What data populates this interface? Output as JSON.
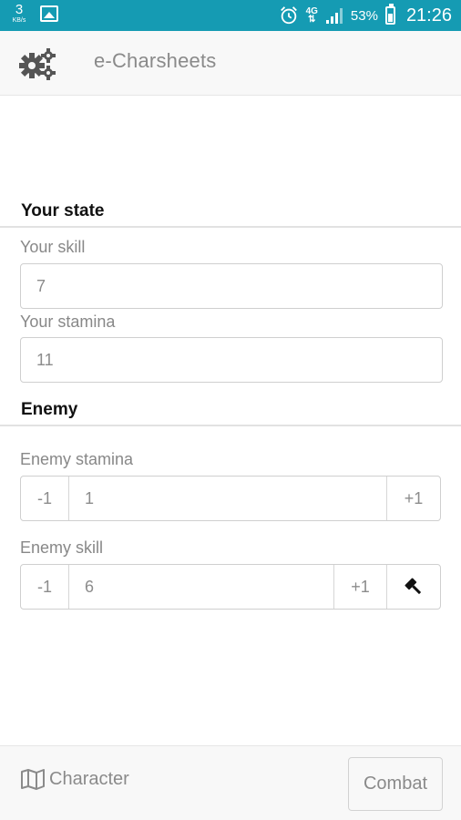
{
  "status_bar": {
    "net_speed": "3",
    "net_unit": "KB/s",
    "network_type": "4G",
    "battery_percent": "53%",
    "battery_level": 0.53,
    "time": "21:26",
    "icons": [
      "gallery-icon",
      "alarm-icon",
      "signal-icon",
      "battery-icon"
    ]
  },
  "header": {
    "title": "e-Charsheets",
    "settings_icon": "gears-icon"
  },
  "your_state": {
    "title": "Your state",
    "skill_label": "Your skill",
    "skill_value": "7",
    "stamina_label": "Your stamina",
    "stamina_value": "11"
  },
  "enemy": {
    "title": "Enemy",
    "stamina_label": "Enemy stamina",
    "stamina_value": "1",
    "skill_label": "Enemy skill",
    "skill_value": "6",
    "minus_label": "-1",
    "plus_label": "+1",
    "attack_icon": "hammer-icon"
  },
  "footer": {
    "character_label": "Character",
    "character_icon": "map-icon",
    "combat_label": "Combat"
  },
  "colors": {
    "status_bar": "#159bb3",
    "header_bg": "#f8f8f8",
    "text_muted": "#8a8a8a",
    "border": "#cfcfcf"
  }
}
